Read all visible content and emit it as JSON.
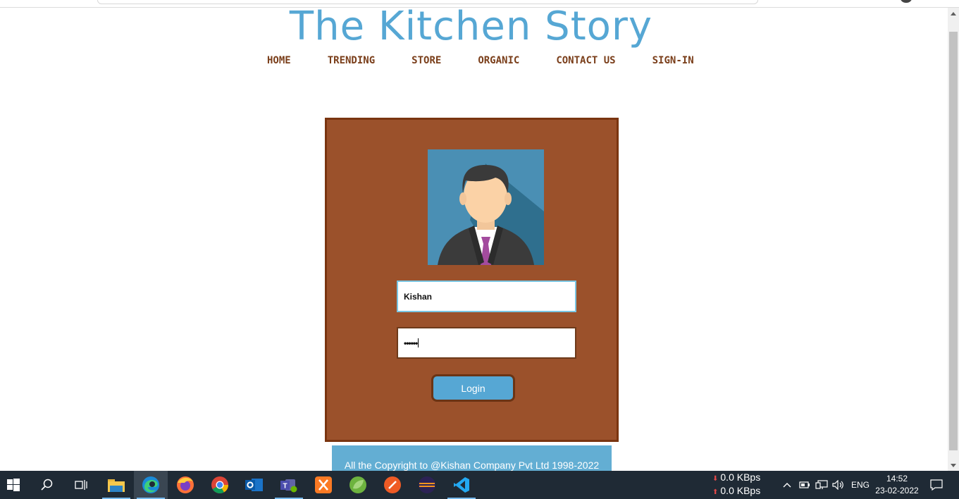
{
  "site": {
    "title": "The Kitchen Story",
    "nav": [
      "HOME",
      "TRENDING",
      "STORE",
      "ORGANIC",
      "CONTACT US",
      "SIGN-IN"
    ]
  },
  "login": {
    "username_value": "Kishan",
    "password_value": "••••••",
    "button_label": "Login"
  },
  "footer": {
    "text": "All the Copyright to @Kishan Company Pvt Ltd 1998-2022"
  },
  "taskbar": {
    "apps": [
      "start-icon",
      "search-icon",
      "task-view-icon",
      "file-explorer-icon",
      "edge-icon",
      "firefox-icon",
      "chrome-icon",
      "outlook-icon",
      "teams-icon",
      "xampp-icon",
      "spring-tool-icon",
      "postman-icon",
      "eclipse-icon",
      "vscode-icon"
    ],
    "net_down": "0.0 KBps",
    "net_up": "0.0 KBps",
    "language": "ENG",
    "time": "14:52",
    "date": "23-02-2022"
  },
  "colors": {
    "title_blue": "#56a7d4",
    "nav_brown": "#7a3e1a",
    "box_brown": "#9b512b",
    "footer_blue": "#63aed3",
    "taskbar": "#1f2a35"
  }
}
